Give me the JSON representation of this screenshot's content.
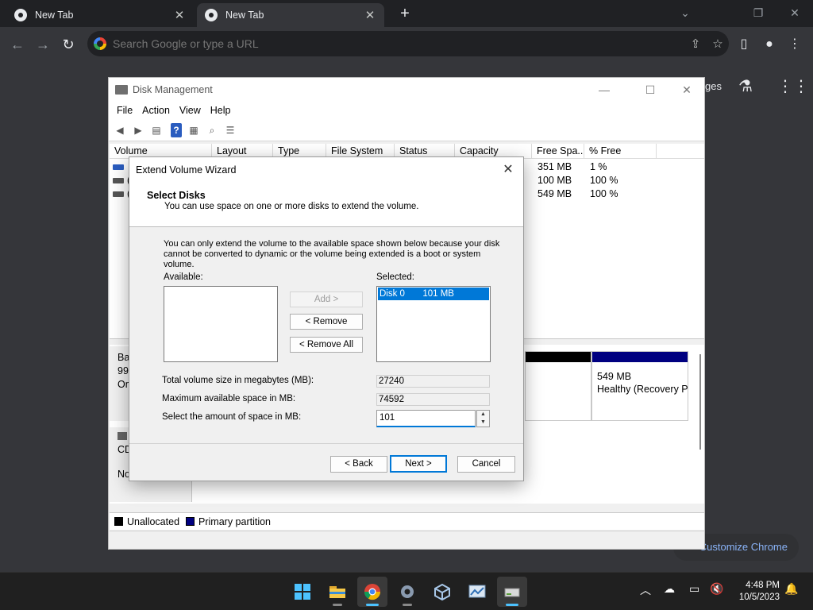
{
  "browser": {
    "tabs": [
      {
        "title": "New Tab"
      },
      {
        "title": "New Tab"
      }
    ],
    "omnibox_placeholder": "Search Google or type a URL",
    "ntp": {
      "shortcut_partial": "ges",
      "customize_label": "Customize Chrome"
    }
  },
  "disk_management": {
    "title": "Disk Management",
    "menu": [
      "File",
      "Action",
      "View",
      "Help"
    ],
    "columns": [
      "Volume",
      "Layout",
      "Type",
      "File System",
      "Status",
      "Capacity",
      "Free Spa...",
      "% Free"
    ],
    "rows": [
      {
        "volume": "",
        "free_space": "351 MB",
        "pct_free": "1 %"
      },
      {
        "volume": "(",
        "free_space": "100 MB",
        "pct_free": "100 %"
      },
      {
        "volume": "(",
        "free_space": "549 MB",
        "pct_free": "100 %"
      }
    ],
    "disk0_label_lines": [
      "Bas",
      "99.",
      "On"
    ],
    "cdrom_label_lines": [
      "CD",
      "No"
    ],
    "recovery_partition": {
      "size": "549 MB",
      "status": "Healthy (Recovery P"
    },
    "legend": {
      "unallocated": "Unallocated",
      "primary": "Primary partition"
    },
    "colors": {
      "unallocated": "#000000",
      "primary": "#000080"
    }
  },
  "wizard": {
    "title": "Extend Volume Wizard",
    "header_title": "Select Disks",
    "header_subtitle": "You can use space on one or more disks to extend the volume.",
    "description": "You can only extend the volume to the available space shown below because your disk cannot be converted to dynamic or the volume being extended is a boot or system volume.",
    "available_label": "Available:",
    "selected_label": "Selected:",
    "add_button": "Add >",
    "remove_button": "< Remove",
    "remove_all_button": "< Remove All",
    "selected_items": [
      {
        "text": "Disk 0       101 MB"
      }
    ],
    "total_size_label": "Total volume size in megabytes (MB):",
    "total_size_value": "27240",
    "max_space_label": "Maximum available space in MB:",
    "max_space_value": "74592",
    "amount_label": "Select the amount of space in MB:",
    "amount_value": "101",
    "back_button": "< Back",
    "next_button": "Next >",
    "cancel_button": "Cancel"
  },
  "taskbar": {
    "time": "4:48 PM",
    "date": "10/5/2023"
  }
}
